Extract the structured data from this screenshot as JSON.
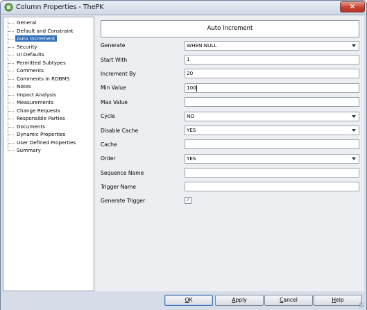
{
  "window": {
    "title": "Column Properties - ThePK",
    "close_symbol": "✕"
  },
  "tree": {
    "items": [
      {
        "label": "General",
        "selected": false
      },
      {
        "label": "Default and Constraint",
        "selected": false
      },
      {
        "label": "Auto Increment",
        "selected": true
      },
      {
        "label": "Security",
        "selected": false
      },
      {
        "label": "UI Defaults",
        "selected": false
      },
      {
        "label": "Permitted Subtypes",
        "selected": false
      },
      {
        "label": "Comments",
        "selected": false
      },
      {
        "label": "Comments in RDBMS",
        "selected": false
      },
      {
        "label": "Notes",
        "selected": false
      },
      {
        "label": "Impact Analysis",
        "selected": false
      },
      {
        "label": "Measurements",
        "selected": false
      },
      {
        "label": "Change Requests",
        "selected": false
      },
      {
        "label": "Responsible Parties",
        "selected": false
      },
      {
        "label": "Documents",
        "selected": false
      },
      {
        "label": "Dynamic Properties",
        "selected": false
      },
      {
        "label": "User Defined Properties",
        "selected": false
      },
      {
        "label": "Summary",
        "selected": false
      }
    ]
  },
  "panel": {
    "header": "Auto Increment",
    "fields": {
      "generate": {
        "label": "Generate",
        "value": "WHEN NULL"
      },
      "start_with": {
        "label": "Start With",
        "value": "1"
      },
      "increment_by": {
        "label": "Increment By",
        "value": "20"
      },
      "min_value": {
        "label": "Min Value",
        "value": "100"
      },
      "max_value": {
        "label": "Max Value",
        "value": ""
      },
      "cycle": {
        "label": "Cycle",
        "value": "NO"
      },
      "disable_cache": {
        "label": "Disable Cache",
        "value": "YES"
      },
      "cache": {
        "label": "Cache",
        "value": ""
      },
      "order": {
        "label": "Order",
        "value": "YES"
      },
      "sequence_name": {
        "label": "Sequence Name",
        "value": ""
      },
      "trigger_name": {
        "label": "Trigger Name",
        "value": ""
      },
      "generate_trigger": {
        "label": "Generate Trigger",
        "checked": true,
        "check_glyph": "✓"
      }
    }
  },
  "footer": {
    "ok": {
      "mnemonic": "O",
      "rest": "K"
    },
    "apply": {
      "mnemonic": "A",
      "rest": "pply"
    },
    "cancel": {
      "mnemonic": "C",
      "rest": "ancel"
    },
    "help": {
      "mnemonic": "H",
      "rest": "elp"
    }
  },
  "colors": {
    "selection": "#2f6fba",
    "window_frame": "#d6dde8",
    "close_button": "#c7402f"
  }
}
